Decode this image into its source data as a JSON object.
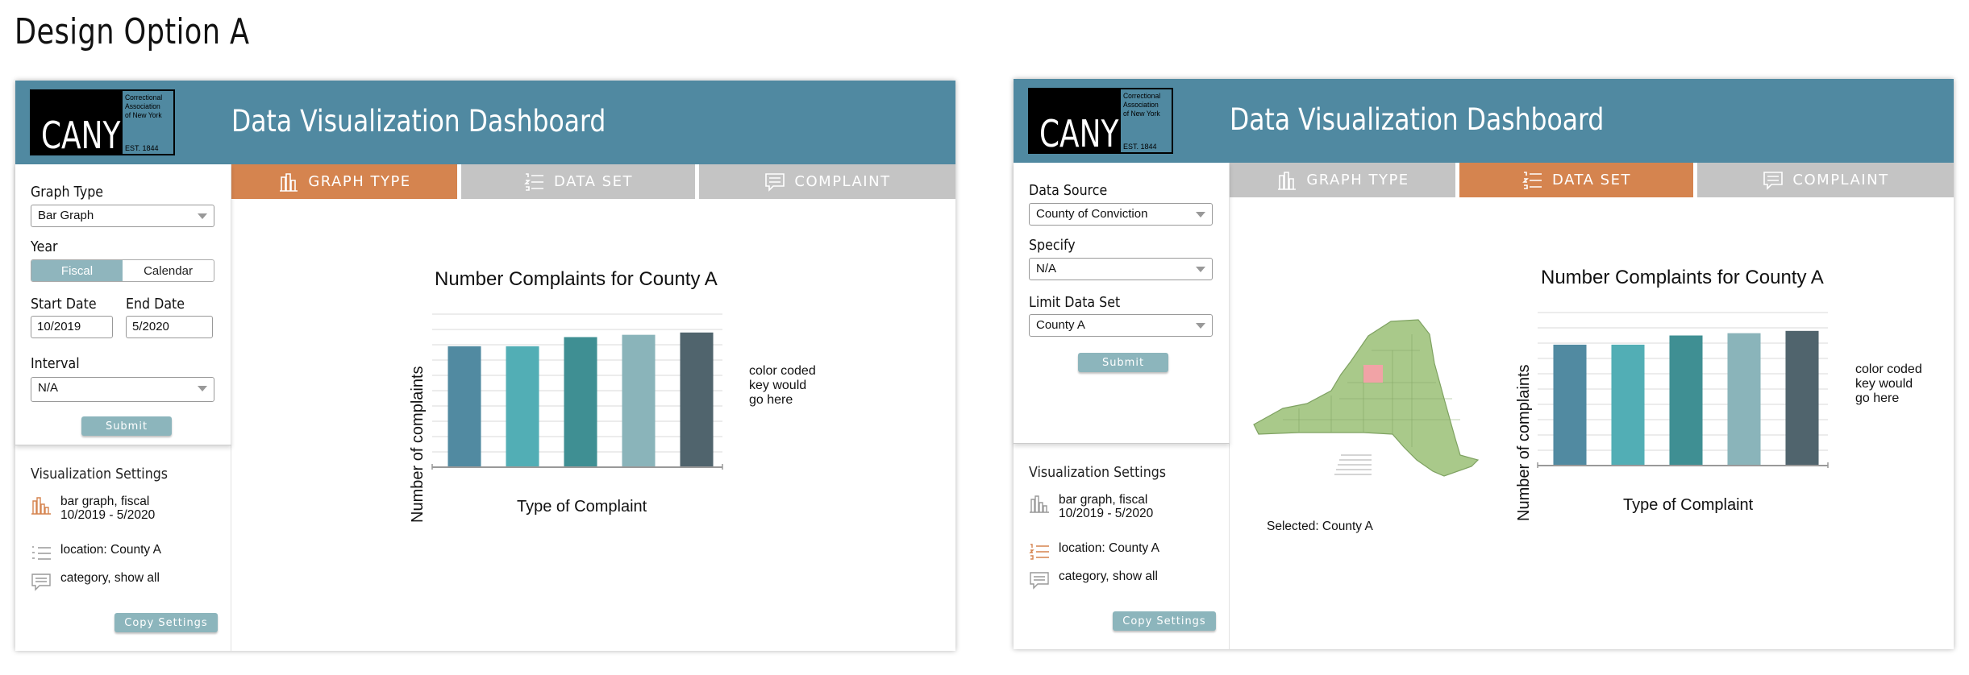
{
  "page_title": "Design Option A",
  "brand": {
    "logo_word": "CANY",
    "logo_text": "Correctional\nAssociation\nof New York",
    "logo_est": "EST. 1844",
    "header_color": "#5089a1"
  },
  "header": {
    "title": "Data Visualization Dashboard"
  },
  "tabs": {
    "graph_type": "GRAPH TYPE",
    "data_set": "DATA SET",
    "complaint": "COMPLAINT",
    "active_color": "#d5844f",
    "inactive_color": "#c4c4c4"
  },
  "panel_a": {
    "graph_type_label": "Graph Type",
    "graph_type_value": "Bar Graph",
    "year_label": "Year",
    "year_options": [
      "Fiscal",
      "Calendar"
    ],
    "year_selected": "Fiscal",
    "start_label": "Start Date",
    "start_value": "10/2019",
    "end_label": "End Date",
    "end_value": "5/2020",
    "interval_label": "Interval",
    "interval_value": "N/A",
    "submit": "Submit"
  },
  "panel_b": {
    "source_label": "Data Source",
    "source_value": "County of Conviction",
    "specify_label": "Specify",
    "specify_value": "N/A",
    "limit_label": "Limit Data Set",
    "limit_value": "County A",
    "submit": "Submit"
  },
  "viz_settings": {
    "title": "Visualization Settings",
    "graph": "bar graph, fiscal\n10/2019 - 5/2020",
    "location": "location: County A",
    "category": "category, show all",
    "copy_button": "Copy Settings"
  },
  "map": {
    "caption": "Selected: County A",
    "icon": "new-york-state-map"
  },
  "chart_data": [
    {
      "type": "bar",
      "title": "Number Complaints for County A",
      "xlabel": "Type of Complaint",
      "ylabel": "Number of complaints",
      "values": [
        7.9,
        7.9,
        8.5,
        8.65,
        8.8
      ],
      "colors": [
        "#518aa1",
        "#52aeb5",
        "#3f8f93",
        "#8ab4ba",
        "#50646d"
      ],
      "ylim": [
        0,
        10
      ],
      "grid": true,
      "legend_placeholder": "color coded\nkey would\ngo here"
    },
    {
      "type": "bar",
      "title": "Number Complaints for County A",
      "xlabel": "Type of Complaint",
      "ylabel": "Number of complaints",
      "values": [
        7.9,
        7.9,
        8.5,
        8.65,
        8.8
      ],
      "colors": [
        "#518aa1",
        "#52aeb5",
        "#3f8f93",
        "#8ab4ba",
        "#50646d"
      ],
      "ylim": [
        0,
        10
      ],
      "grid": true,
      "legend_placeholder": "color coded\nkey would\ngo here"
    }
  ]
}
